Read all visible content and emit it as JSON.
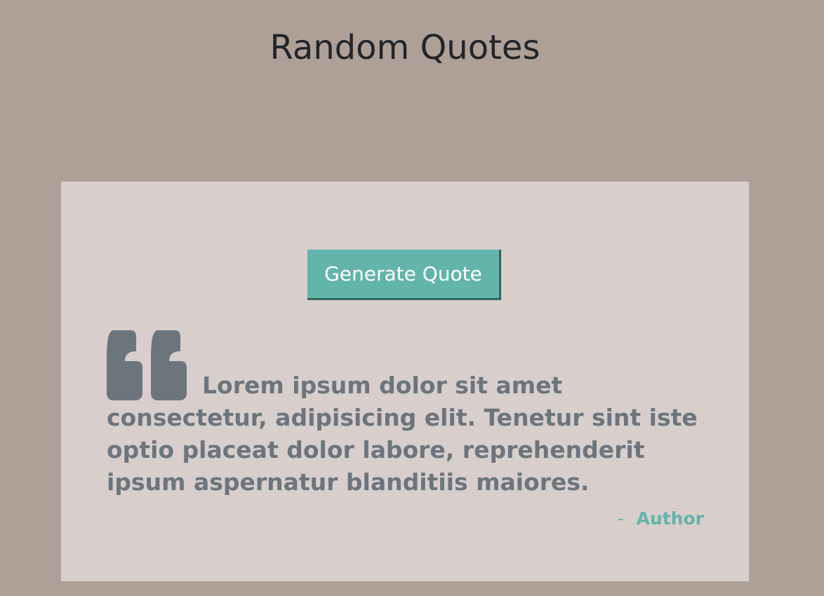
{
  "header": {
    "title": "Random Quotes"
  },
  "card": {
    "generate_button_label": "Generate Quote",
    "quote_text": "Lorem ipsum dolor sit amet consectetur, adipisicing elit. Tenetur sint iste optio placeat dolor labore, reprehenderit ipsum aspernatur blanditiis maiores.",
    "author_dash": "-",
    "author": "Author",
    "quote_icon": "quote-left-icon"
  },
  "colors": {
    "background": "#afa097",
    "card_background": "#d8cecc",
    "accent": "#63b4aa",
    "quote_text": "#6c757d",
    "title_text": "#212529"
  }
}
